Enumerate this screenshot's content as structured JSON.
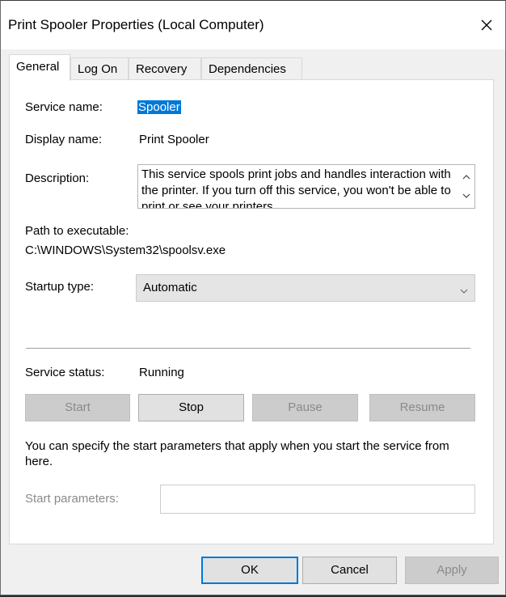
{
  "window": {
    "title": "Print Spooler Properties (Local Computer)"
  },
  "tabs": [
    {
      "label": "General",
      "active": true
    },
    {
      "label": "Log On",
      "active": false
    },
    {
      "label": "Recovery",
      "active": false
    },
    {
      "label": "Dependencies",
      "active": false
    }
  ],
  "general": {
    "service_name_label": "Service name:",
    "service_name_value": "Spooler",
    "display_name_label": "Display name:",
    "display_name_value": "Print Spooler",
    "description_label": "Description:",
    "description_value": "This service spools print jobs and handles interaction with the printer.  If you turn off this service, you won't be able to print or see your printers.",
    "path_label": "Path to executable:",
    "path_value": "C:\\WINDOWS\\System32\\spoolsv.exe",
    "startup_type_label": "Startup type:",
    "startup_type_value": "Automatic",
    "service_status_label": "Service status:",
    "service_status_value": "Running",
    "buttons": {
      "start": "Start",
      "stop": "Stop",
      "pause": "Pause",
      "resume": "Resume"
    },
    "start_params_hint": "You can specify the start parameters that apply when you start the service from here.",
    "start_params_label": "Start parameters:",
    "start_params_value": ""
  },
  "footer": {
    "ok": "OK",
    "cancel": "Cancel",
    "apply": "Apply"
  },
  "colors": {
    "selection": "#0078d7",
    "default_button_border": "#0078d7",
    "disabled_text": "#8a8a8a"
  }
}
